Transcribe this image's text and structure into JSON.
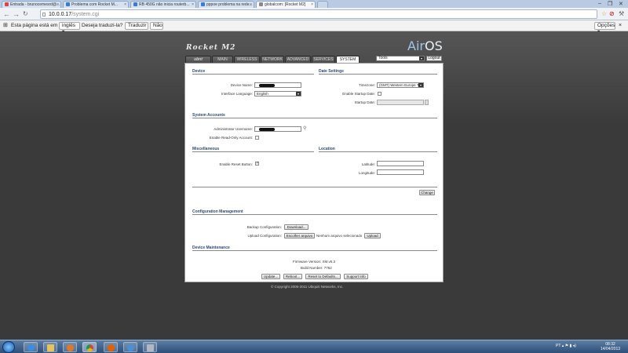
{
  "browser": {
    "tabs": [
      {
        "label": "Entrada - brunocemesrd@...",
        "active": false
      },
      {
        "label": "Problema com Rocket M...",
        "active": false
      },
      {
        "label": "RB 450G não inicia routerb...",
        "active": false
      },
      {
        "label": "pppoe problema na rede...",
        "active": false
      },
      {
        "label": "globalcom: [Rocket M2]",
        "active": true
      }
    ],
    "url_host": "10.0.0.17",
    "url_path": "/system.cgi",
    "translate": {
      "prefix": "Esta página está em",
      "language": "inglês",
      "question": "Deseja traduzi-la?",
      "translate_button": "Traduzir",
      "no_button": "Não",
      "options_button": "Opções"
    }
  },
  "header": {
    "brand": "Rocket M2",
    "logo_air": "Air",
    "logo_os": "OS",
    "tools_select": "Tools",
    "logout": "Logout"
  },
  "nav_tabs": [
    "MAIN",
    "WIRELESS",
    "NETWORK",
    "ADVANCED",
    "SERVICES",
    "SYSTEM"
  ],
  "device": {
    "title": "Device",
    "name_label": "Device Name:",
    "language_label": "Interface Language:",
    "language_value": "English"
  },
  "date_settings": {
    "title": "Date Settings",
    "timezone_label": "Timezone:",
    "timezone_value": "(GMT) Western Europe T",
    "startup_date_enable_label": "Enable Startup Date:",
    "startup_date_label": "Startup Date:"
  },
  "accounts": {
    "title": "System Accounts",
    "admin_label": "Administrator Username:",
    "readonly_label": "Enable Read-Only Account:"
  },
  "misc": {
    "title": "Miscellaneous",
    "reset_label": "Enable Reset Button:",
    "reset_checked": true
  },
  "location": {
    "title": "Location",
    "latitude_label": "Latitude:",
    "longitude_label": "Longitude:"
  },
  "change_button": "Change",
  "config": {
    "title": "Configuration Management",
    "backup_label": "Backup Configuration:",
    "download_button": "Download...",
    "upload_label": "Upload Configuration:",
    "choose_file_button": "Escolher arquivo",
    "no_file_text": "Nenhum arquivo selecionado",
    "upload_button": "Upload"
  },
  "maintenance": {
    "title": "Device Maintenance",
    "firmware": "Firmware Version: XM.v5.3",
    "build": "Build Number: 7762",
    "update_button": "Update...",
    "reboot_button": "Reboot...",
    "reset_defaults_button": "Reset to Defaults...",
    "support_button": "Support Info"
  },
  "copyright": "© Copyright 2006-2011 Ubiquiti Networks, Inc.",
  "taskbar": {
    "language": "PT",
    "time": "08:32",
    "date": "14/04/2013"
  },
  "colors": {
    "section_heading": "#2d4a78",
    "logo_blue": "#9ec5ea",
    "page_bg": "#3a3a3a"
  }
}
